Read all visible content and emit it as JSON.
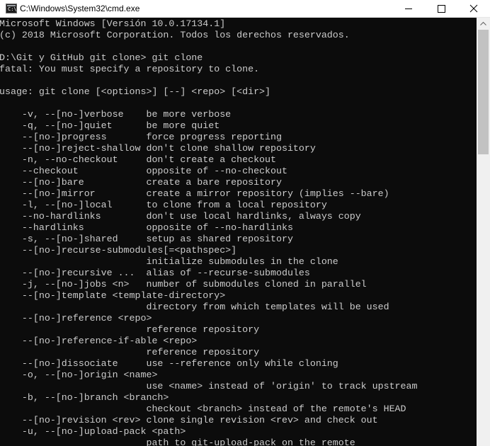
{
  "window": {
    "title": "C:\\Windows\\System32\\cmd.exe",
    "icons": {
      "app": "cmd-icon",
      "minimize": "minimize-icon",
      "maximize": "maximize-icon",
      "close": "close-icon",
      "scroll_up": "chevron-up-icon"
    }
  },
  "colors": {
    "terminal_bg": "#0c0c0c",
    "terminal_text": "#cccccc",
    "titlebar_bg": "#ffffff",
    "scrollbar_track": "#f0f0f0",
    "scrollbar_thumb": "#c2c2c2"
  },
  "scrollbar": {
    "position_fraction": 0.0,
    "visible_fraction": 0.3
  },
  "terminal": {
    "lines": [
      "Microsoft Windows [Versión 10.0.17134.1]",
      "(c) 2018 Microsoft Corporation. Todos los derechos reservados.",
      "",
      "D:\\Git y GitHub git clone> git clone",
      "fatal: You must specify a repository to clone.",
      "",
      "usage: git clone [<options>] [--] <repo> [<dir>]",
      "",
      "    -v, --[no-]verbose    be more verbose",
      "    -q, --[no-]quiet      be more quiet",
      "    --[no-]progress       force progress reporting",
      "    --[no-]reject-shallow don't clone shallow repository",
      "    -n, --no-checkout     don't create a checkout",
      "    --checkout            opposite of --no-checkout",
      "    --[no-]bare           create a bare repository",
      "    --[no-]mirror         create a mirror repository (implies --bare)",
      "    -l, --[no-]local      to clone from a local repository",
      "    --no-hardlinks        don't use local hardlinks, always copy",
      "    --hardlinks           opposite of --no-hardlinks",
      "    -s, --[no-]shared     setup as shared repository",
      "    --[no-]recurse-submodules[=<pathspec>]",
      "                          initialize submodules in the clone",
      "    --[no-]recursive ...  alias of --recurse-submodules",
      "    -j, --[no-]jobs <n>   number of submodules cloned in parallel",
      "    --[no-]template <template-directory>",
      "                          directory from which templates will be used",
      "    --[no-]reference <repo>",
      "                          reference repository",
      "    --[no-]reference-if-able <repo>",
      "                          reference repository",
      "    --[no-]dissociate     use --reference only while cloning",
      "    -o, --[no-]origin <name>",
      "                          use <name> instead of 'origin' to track upstream",
      "    -b, --[no-]branch <branch>",
      "                          checkout <branch> instead of the remote's HEAD",
      "    --[no-]revision <rev> clone single revision <rev> and check out",
      "    -u, --[no-]upload-pack <path>",
      "                          path to git-upload-pack on the remote"
    ]
  }
}
